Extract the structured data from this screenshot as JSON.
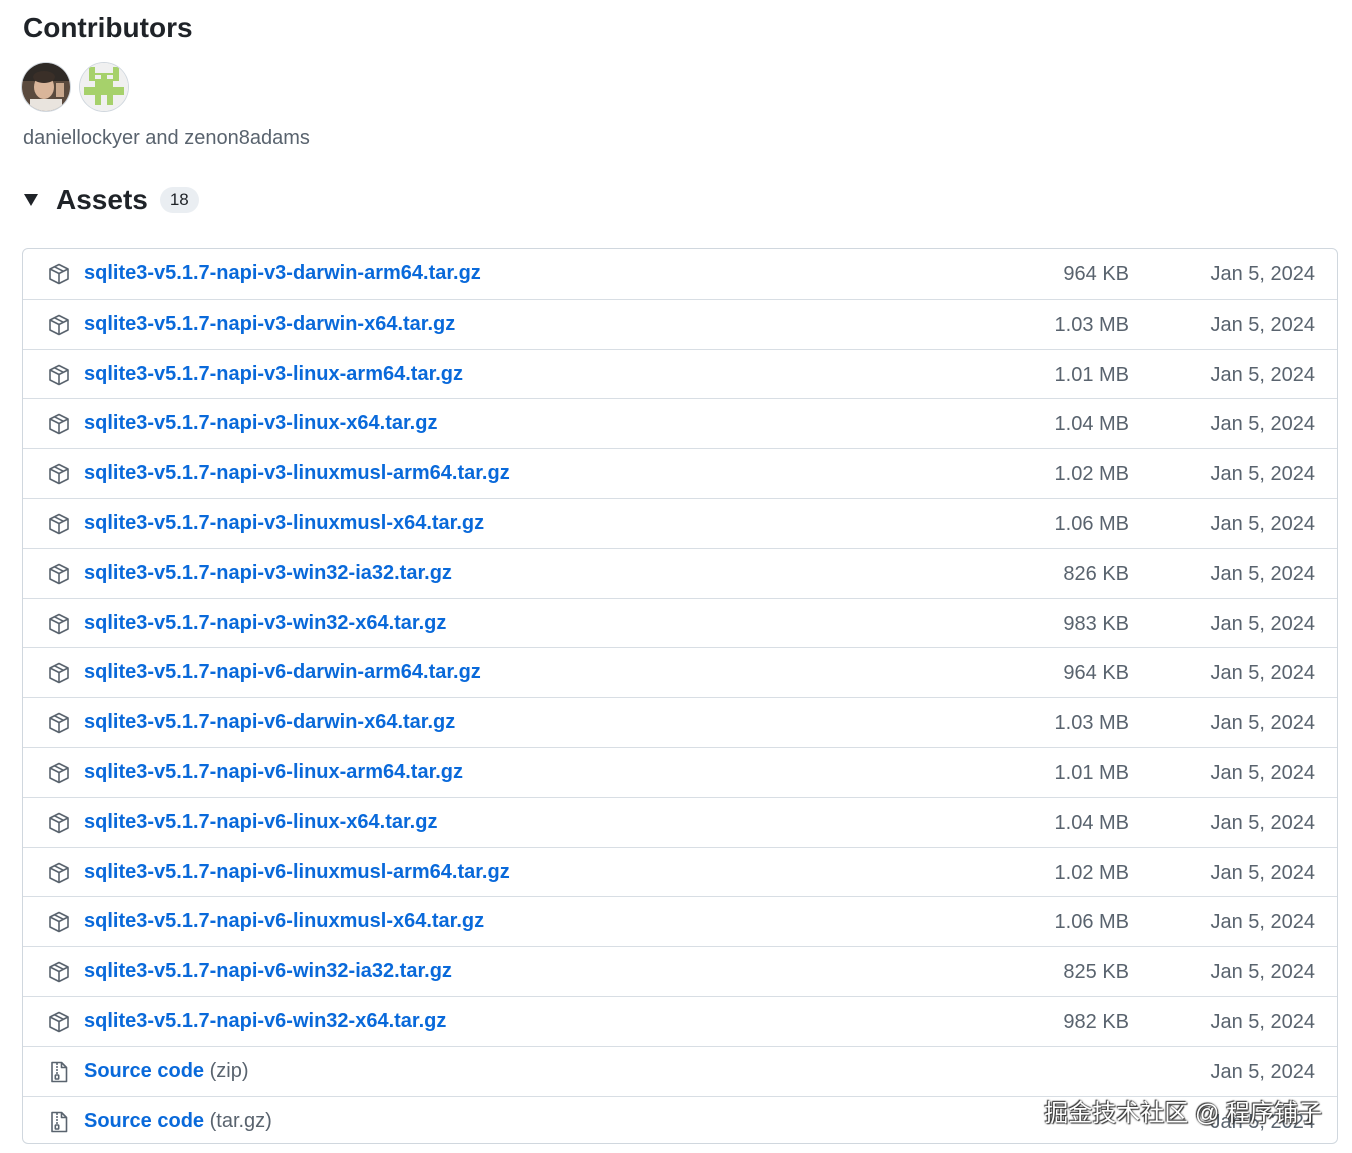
{
  "contributors": {
    "title": "Contributors",
    "names": "daniellockyer and zenon8adams"
  },
  "assets": {
    "title": "Assets",
    "count": "18",
    "items": [
      {
        "name": "sqlite3-v5.1.7-napi-v3-darwin-arm64.tar.gz",
        "suffix": "",
        "size": "964 KB",
        "date": "Jan 5, 2024",
        "icon": "package-icon"
      },
      {
        "name": "sqlite3-v5.1.7-napi-v3-darwin-x64.tar.gz",
        "suffix": "",
        "size": "1.03 MB",
        "date": "Jan 5, 2024",
        "icon": "package-icon"
      },
      {
        "name": "sqlite3-v5.1.7-napi-v3-linux-arm64.tar.gz",
        "suffix": "",
        "size": "1.01 MB",
        "date": "Jan 5, 2024",
        "icon": "package-icon"
      },
      {
        "name": "sqlite3-v5.1.7-napi-v3-linux-x64.tar.gz",
        "suffix": "",
        "size": "1.04 MB",
        "date": "Jan 5, 2024",
        "icon": "package-icon"
      },
      {
        "name": "sqlite3-v5.1.7-napi-v3-linuxmusl-arm64.tar.gz",
        "suffix": "",
        "size": "1.02 MB",
        "date": "Jan 5, 2024",
        "icon": "package-icon"
      },
      {
        "name": "sqlite3-v5.1.7-napi-v3-linuxmusl-x64.tar.gz",
        "suffix": "",
        "size": "1.06 MB",
        "date": "Jan 5, 2024",
        "icon": "package-icon"
      },
      {
        "name": "sqlite3-v5.1.7-napi-v3-win32-ia32.tar.gz",
        "suffix": "",
        "size": "826 KB",
        "date": "Jan 5, 2024",
        "icon": "package-icon"
      },
      {
        "name": "sqlite3-v5.1.7-napi-v3-win32-x64.tar.gz",
        "suffix": "",
        "size": "983 KB",
        "date": "Jan 5, 2024",
        "icon": "package-icon"
      },
      {
        "name": "sqlite3-v5.1.7-napi-v6-darwin-arm64.tar.gz",
        "suffix": "",
        "size": "964 KB",
        "date": "Jan 5, 2024",
        "icon": "package-icon"
      },
      {
        "name": "sqlite3-v5.1.7-napi-v6-darwin-x64.tar.gz",
        "suffix": "",
        "size": "1.03 MB",
        "date": "Jan 5, 2024",
        "icon": "package-icon"
      },
      {
        "name": "sqlite3-v5.1.7-napi-v6-linux-arm64.tar.gz",
        "suffix": "",
        "size": "1.01 MB",
        "date": "Jan 5, 2024",
        "icon": "package-icon"
      },
      {
        "name": "sqlite3-v5.1.7-napi-v6-linux-x64.tar.gz",
        "suffix": "",
        "size": "1.04 MB",
        "date": "Jan 5, 2024",
        "icon": "package-icon"
      },
      {
        "name": "sqlite3-v5.1.7-napi-v6-linuxmusl-arm64.tar.gz",
        "suffix": "",
        "size": "1.02 MB",
        "date": "Jan 5, 2024",
        "icon": "package-icon"
      },
      {
        "name": "sqlite3-v5.1.7-napi-v6-linuxmusl-x64.tar.gz",
        "suffix": "",
        "size": "1.06 MB",
        "date": "Jan 5, 2024",
        "icon": "package-icon"
      },
      {
        "name": "sqlite3-v5.1.7-napi-v6-win32-ia32.tar.gz",
        "suffix": "",
        "size": "825 KB",
        "date": "Jan 5, 2024",
        "icon": "package-icon"
      },
      {
        "name": "sqlite3-v5.1.7-napi-v6-win32-x64.tar.gz",
        "suffix": "",
        "size": "982 KB",
        "date": "Jan 5, 2024",
        "icon": "package-icon"
      },
      {
        "name": "Source code",
        "suffix": " (zip)",
        "size": "",
        "date": "Jan 5, 2024",
        "icon": "file-zip-icon"
      },
      {
        "name": "Source code",
        "suffix": " (tar.gz)",
        "size": "",
        "date": "Jan 5, 2024",
        "icon": "file-zip-icon"
      }
    ]
  },
  "watermark": "掘金技术社区 @ 程序铺子",
  "colors": {
    "link": "#0969da",
    "muted": "#59636e",
    "border": "#d0d7de",
    "identicon": "#a6d16b"
  }
}
